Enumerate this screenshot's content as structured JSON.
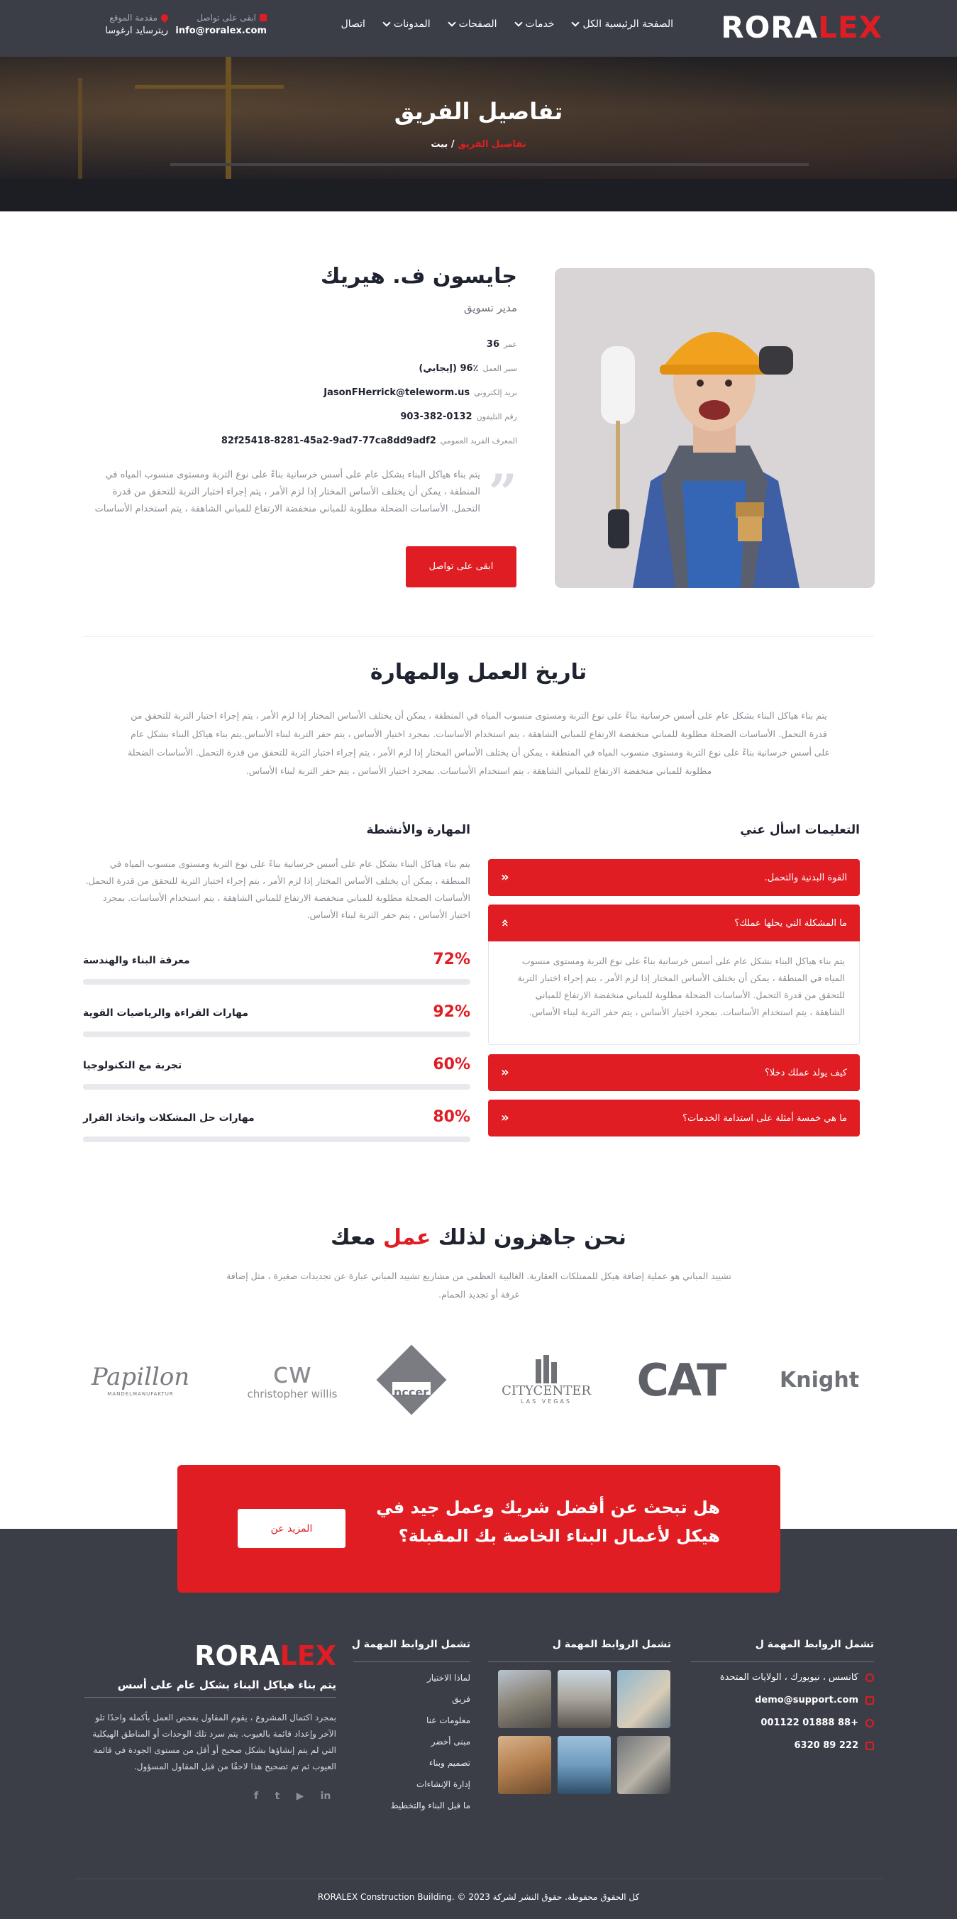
{
  "header": {
    "logo_white": "RORA",
    "logo_red": "LEX",
    "nav": [
      {
        "label": "الصفحة الرئيسية الكل",
        "dropdown": true
      },
      {
        "label": "خدمات",
        "dropdown": true
      },
      {
        "label": "الصفحات",
        "dropdown": true
      },
      {
        "label": "المدونات",
        "dropdown": true
      },
      {
        "label": "اتصال",
        "dropdown": false
      }
    ],
    "email_label": "ابقى على تواصل",
    "email_value": "info@roralex.com",
    "location_label": "مقدمة الموقع",
    "location_value": "ريترسايد ارغوسا"
  },
  "banner": {
    "title": "تفاصيل الفريق",
    "crumb_home": "بيت",
    "crumb_sep": "/",
    "crumb_current": "تفاصيل الفريق"
  },
  "profile": {
    "name": "جايسون ف. هيريك",
    "role": "مدير تسويق",
    "rows": [
      {
        "label": "عمر",
        "value": "36"
      },
      {
        "label": "سير العمل",
        "value": "96٪ (إيجابي)"
      },
      {
        "label": "بريد إلكتروني",
        "value": "JasonFHerrick@teleworm.us"
      },
      {
        "label": "رقم التليفون",
        "value": "903-382-0132"
      },
      {
        "label": "المعرف الفريد العمومي",
        "value": "82f25418-8281-45a2-9ad7-77ca8dd9adf2"
      }
    ],
    "quote": "يتم بناء هياكل البناء بشكل عام على أسس خرسانية بناءً على نوع التربة ومستوى منسوب المياه في المنطقة ، يمكن أن يختلف الأساس المختار إذا لزم الأمر ، يتم إجراء اختبار التربة للتحقق من قدرة التحمل. الأساسات الضحلة مطلوبة للمباني منخفضة الارتفاع للمباني الشاهقة ، يتم استخدام الأساسات",
    "button": "ابقى على تواصل"
  },
  "history": {
    "title": "تاريخ العمل والمهارة",
    "text": "يتم بناء هياكل البناء بشكل عام على أسس خرسانية بناءً على نوع التربة ومستوى منسوب المياه في المنطقة ، يمكن أن يختلف الأساس المختار إذا لزم الأمر ، يتم إجراء اختبار التربة للتحقق من قدرة التحمل. الأساسات الضحلة مطلوبة للمباني منخفضة الارتفاع للمباني الشاهقة ، يتم استخدام الأساسات. بمجرد اختيار الأساس ، يتم حفر التربة لبناء الأساس.يتم بناء هياكل البناء بشكل عام على أسس خرسانية بناءً على نوع التربة ومستوى منسوب المياه في المنطقة ، يمكن أن يختلف الأساس المختار إذا لزم الأمر ، يتم إجراء اختبار التربة للتحقق من قدرة التحمل. الأساسات الضحلة مطلوبة للمباني منخفضة الارتفاع للمباني الشاهقة ، يتم استخدام الأساسات. بمجرد اختيار الأساس ، يتم حفر التربة لبناء الأساس."
  },
  "faq": {
    "title": "التعليمات اسأل عني",
    "items": [
      {
        "q": "القوة البدنية والتحمل.",
        "open": false
      },
      {
        "q": "ما المشكلة التي يحلها عملك؟",
        "open": true
      },
      {
        "q": "كيف يولد عملك دخلا؟",
        "open": false
      },
      {
        "q": "ما هي خمسة أمثلة على استدامة الخدمات؟",
        "open": false
      }
    ],
    "answer": "يتم بناء هياكل البناء بشكل عام على أسس خرسانية بناءً على نوع التربة ومستوى منسوب المياه في المنطقة ، يمكن أن يختلف الأساس المختار إذا لزم الأمر ، يتم إجراء اختبار التربة للتحقق من قدرة التحمل. الأساسات الضحلة مطلوبة للمباني منخفضة الارتفاع للمباني الشاهقة ، يتم استخدام الأساسات. بمجرد اختيار الأساس ، يتم حفر التربة لبناء الأساس."
  },
  "skills": {
    "title": "المهارة والأنشطة",
    "text": "يتم بناء هياكل البناء بشكل عام على أسس خرسانية بناءً على نوع التربة ومستوى منسوب المياه في المنطقة ، يمكن أن يختلف الأساس المختار إذا لزم الأمر ، يتم إجراء اختبار التربة للتحقق من قدرة التحمل. الأساسات الضحلة مطلوبة للمباني منخفضة الارتفاع للمباني الشاهقة ، يتم استخدام الأساسات. بمجرد اختيار الأساس ، يتم حفر التربة لبناء الأساس.",
    "items": [
      {
        "label": "معرفة البناء والهندسة",
        "percent_text": "72%",
        "percent": 72
      },
      {
        "label": "مهارات القراءة والرياضيات القوية",
        "percent_text": "92%",
        "percent": 92
      },
      {
        "label": "تجربة مع التكنولوجيا",
        "percent_text": "60%",
        "percent": 60
      },
      {
        "label": "مهارات حل المشكلات واتخاذ القرار",
        "percent_text": "80%",
        "percent": 80
      }
    ]
  },
  "ready": {
    "title_part1": "نحن جاهزون لذلك",
    "title_accent": "عمل",
    "title_part2": "معك",
    "text": "تشييد المباني هو عملية إضافة هيكل للممتلكات العقارية. الغالبية العظمى من مشاريع تشييد المباني عبارة عن تجديدات صغيرة ، مثل إضافة غرفة أو تجديد الحمام."
  },
  "brands": {
    "papillon": "Papillon",
    "papillon_sub": "MANDELMANUFAKTUR",
    "cw_mark": "cw",
    "cw_name": "christopher willis",
    "nccer": "nccer",
    "citycenter": "CITYCENTER",
    "citycenter_sub": "LAS VEGAS",
    "cat": "CAT",
    "knight": "Knight"
  },
  "cta": {
    "text": "هل تبحث عن أفضل شريك وعمل جيد في هيكل لأعمال البناء الخاصة بك المقبلة؟",
    "button": "المزيد عن"
  },
  "footer": {
    "col1_title": "تشمل الروابط المهمة ل",
    "contact": [
      {
        "icon": "globe-icon",
        "value": "كانسس ، نيويورك ، الولايات المتحدة"
      },
      {
        "icon": "mail-icon",
        "value": "demo@support.com"
      },
      {
        "icon": "phone-icon",
        "value": "+88 01888 001122"
      },
      {
        "icon": "fax-icon",
        "value": "222 89 6320"
      }
    ],
    "col2_title": "تشمل الروابط المهمة ل",
    "col3_title": "تشمل الروابط المهمة ل",
    "links": [
      "لماذا الاختيار",
      "فريق",
      "معلومات عنا",
      "مبنى أخضر",
      "تصميم وبناء",
      "إدارة الإنشاءات",
      "ما قبل البناء والتخطيط"
    ],
    "logo_white": "RORA",
    "logo_red": "LEX",
    "tagline": "يتم بناء هياكل البناء بشكل عام على أسس",
    "desc": "بمجرد اكتمال المشروع ، يقوم المقاول بفحص العمل بأكمله واحدًا تلو الآخر وإعداد قائمة بالعيوب. يتم سرد تلك الوحدات أو المناطق الهيكلية التي لم يتم إنشاؤها بشكل صحيح أو أقل من مستوى الجودة في قائمة العيوب ثم تم تصحيح هذا لاحقًا من قبل المقاول المسؤول.",
    "social": [
      "f",
      "t",
      "▶",
      "in"
    ],
    "copyright": "كل الحقوق محفوظة. حقوق النشر لشركة RORALEX Construction Building. © 2023"
  },
  "colors": {
    "accent": "#e01d23",
    "dark": "#3b3e47"
  }
}
